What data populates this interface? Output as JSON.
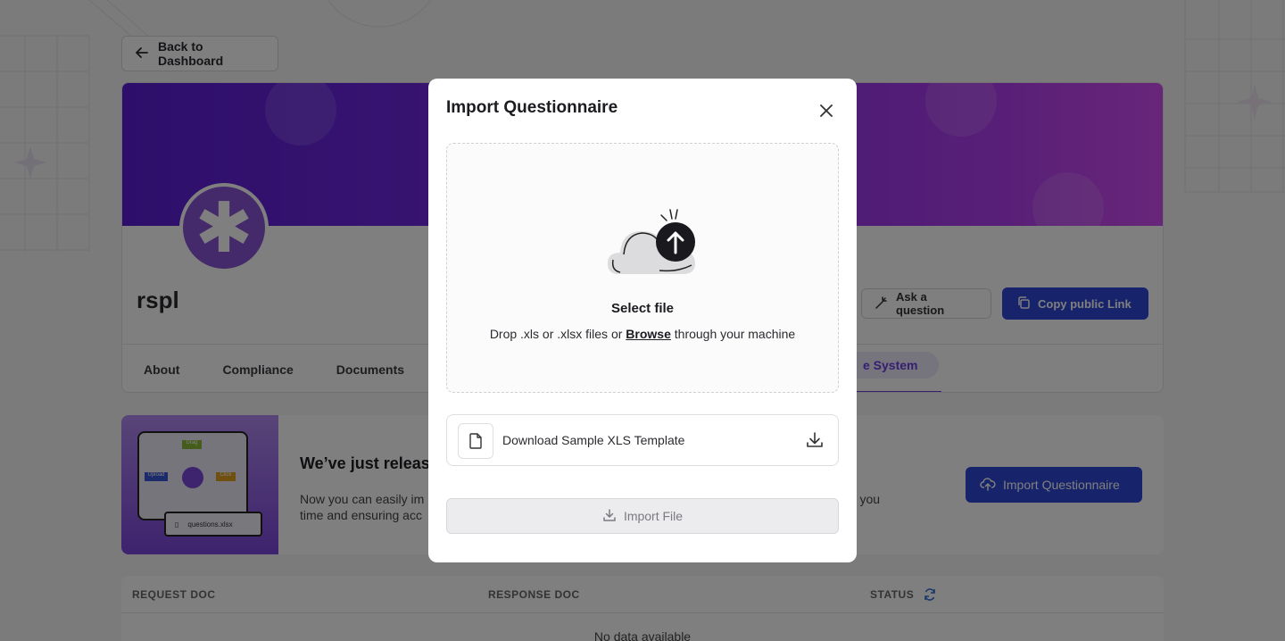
{
  "page": {
    "back_label": "Back to Dashboard",
    "org_name": "rspl",
    "ask_label": "Ask a question",
    "copy_label": "Copy public Link",
    "tabs": [
      "About",
      "Compliance",
      "Documents"
    ],
    "active_tab_partial": "e System",
    "promo": {
      "title": "We’ve just releas",
      "line1": "Now you can easily im",
      "line1_tail": "ng you",
      "line2": "time and ensuring acc",
      "import_label": "Import Questionnaire",
      "art_labels": {
        "top": "Drag",
        "left": "Upload",
        "right": "Click",
        "file": "questions.xlsx"
      }
    },
    "table": {
      "headers": [
        "REQUEST DOC",
        "RESPONSE DOC",
        "STATUS"
      ],
      "empty": "No data available"
    }
  },
  "modal": {
    "title": "Import Questionnaire",
    "select_file": "Select file",
    "drop_prefix": "Drop .xls or .xlsx files or ",
    "browse": "Browse",
    "drop_suffix": " through your machine",
    "template_label": "Download Sample XLS Template",
    "import_button": "Import File"
  },
  "colors": {
    "primary": "#2f47d6",
    "accent": "#6a3ee0",
    "overlay": "rgba(0,0,0,0.5)"
  }
}
